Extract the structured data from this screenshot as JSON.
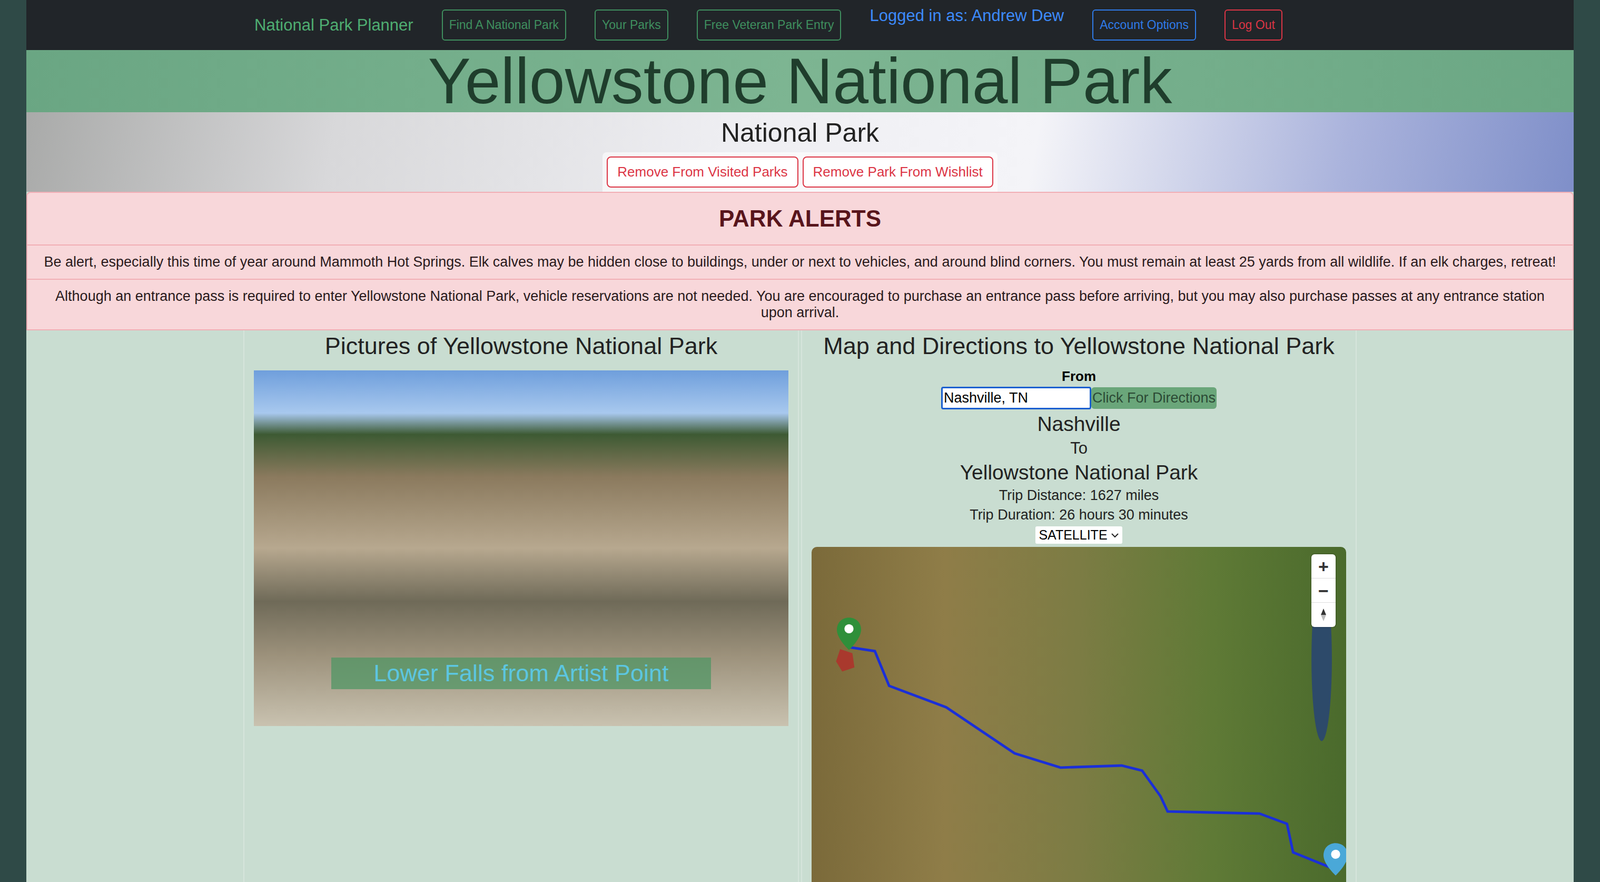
{
  "nav": {
    "brand": "National Park Planner",
    "links": [
      {
        "label": "Find A National Park"
      },
      {
        "label": "Your Parks"
      },
      {
        "label": "Free Veteran Park Entry"
      }
    ],
    "user": "Logged in as: Andrew Dew",
    "account": "Account Options",
    "logout": "Log Out"
  },
  "park": {
    "title": "Yellowstone National Park",
    "designation": "National Park",
    "actions": [
      "Remove From Visited Parks",
      "Remove Park From Wishlist"
    ]
  },
  "alerts": {
    "title": "PARK ALERTS",
    "items": [
      "Be alert, especially this time of year around Mammoth Hot Springs. Elk calves may be hidden close to buildings, under or next to vehicles, and around blind corners. You must remain at least 25 yards from all wildlife. If an elk charges, retreat!",
      "Although an entrance pass is required to enter Yellowstone National Park, vehicle reservations are not needed. You are encouraged to purchase an entrance pass before arriving, but you may also purchase passes at any entrance station upon arrival."
    ]
  },
  "pictures": {
    "title": "Pictures of Yellowstone National Park",
    "caption": "Lower Falls from Artist Point"
  },
  "directions": {
    "title": "Map and Directions to Yellowstone National Park",
    "from_label": "From",
    "from_value": "Nashville, TN",
    "button": "Click For Directions",
    "origin": "Nashville",
    "to": "To",
    "destination": "Yellowstone National Park",
    "distance": "Trip Distance: 1627 miles",
    "duration": "Trip Duration: 26 hours 30 minutes",
    "map_type": "SATELLITE",
    "zoom_in": "+",
    "zoom_out": "−"
  }
}
